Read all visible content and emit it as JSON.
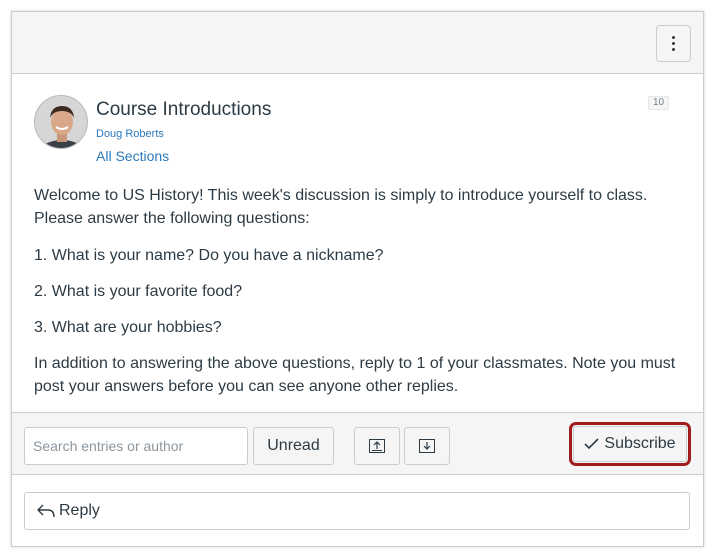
{
  "topic": {
    "title": "Course Introductions",
    "author": "Doug Roberts",
    "sections": "All Sections",
    "entry_count": "10"
  },
  "body": {
    "paragraphs": [
      "Welcome to US History! This week's discussion is simply to introduce yourself to class. Please answer the following questions:",
      "1. What is your name? Do you have a nickname?",
      "2. What is your favorite food?",
      "3. What are your hobbies?",
      "In addition to answering the above questions, reply to 1 of your classmates. Note you must post your answers before you can see anyone other replies."
    ]
  },
  "toolbar": {
    "search_placeholder": "Search entries or author",
    "unread_label": "Unread",
    "subscribe_label": "Subscribe"
  },
  "reply": {
    "label": "Reply"
  },
  "colors": {
    "link": "#2b7abc",
    "highlight": "#a01b1b",
    "text": "#2d3b45"
  }
}
